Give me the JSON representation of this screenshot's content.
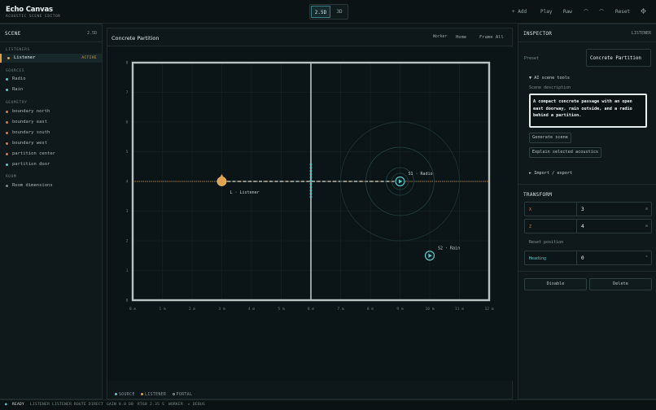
{
  "app": {
    "title": "Echo Canvas",
    "subtitle": "ACOUSTIC SCENE EDITOR"
  },
  "toolbar": {
    "mode_2d": "2.5D",
    "mode_3d": "3D",
    "add": "+ Add",
    "play": "Play",
    "raw": "Raw",
    "undo": "⌒",
    "redo": "⌒",
    "reset": "Reset",
    "settings_icon": "gear-icon"
  },
  "scene": {
    "title": "SCENE",
    "mode": "2.5D",
    "sections": {
      "listeners": "LISTENERS",
      "sources": "SOURCES",
      "geometry": "GEOMETRY",
      "room": "ROOM"
    },
    "listeners": [
      {
        "label": "Listener",
        "badge": "ACTIVE",
        "color": "#d9a14a"
      }
    ],
    "sources": [
      {
        "label": "Radio",
        "color": "#5fc9c9"
      },
      {
        "label": "Rain",
        "color": "#5fc9c9"
      }
    ],
    "geometry": [
      {
        "label": "boundary north",
        "color": "#d97c4a"
      },
      {
        "label": "boundary east",
        "color": "#d97c4a"
      },
      {
        "label": "boundary south",
        "color": "#d97c4a"
      },
      {
        "label": "boundary west",
        "color": "#d97c4a"
      },
      {
        "label": "partition center",
        "color": "#d97c4a"
      },
      {
        "label": "partition door",
        "color": "#5fc9c9"
      }
    ],
    "room": [
      {
        "label": "Room dimensions",
        "color": "#7d8d8f"
      }
    ]
  },
  "viewport": {
    "title": "Concrete Partition",
    "worker": "Worker",
    "home": "Home",
    "frame_all": "Frame All",
    "x_ticks": [
      "0 m",
      "1 m",
      "2 m",
      "3 m",
      "4 m",
      "5 m",
      "6 m",
      "7 m",
      "8 m",
      "9 m",
      "10 m",
      "11 m",
      "12 m"
    ],
    "z_ticks": [
      "8",
      "7",
      "6",
      "5",
      "4",
      "3",
      "2",
      "1",
      "0"
    ],
    "listener_label": "L · Listener",
    "source1_label": "S1 · Radio",
    "source2_label": "S2 · Rain",
    "legend": {
      "source": "SOURCE",
      "listener": "LISTENER",
      "portal": "PORTAL"
    },
    "listener_pos": {
      "x": 3,
      "z": 4
    },
    "source1_pos": {
      "x": 9,
      "z": 4
    },
    "source2_pos": {
      "x": 10,
      "z": 1.5
    },
    "colors": {
      "source": "#5fc9c9",
      "listener": "#e0a24e",
      "wall": "#b8c2c2"
    }
  },
  "inspector": {
    "title": "INSPECTOR",
    "context": "LISTENER",
    "preset_label": "Preset",
    "preset_value": "Concrete Partition",
    "ai_tools": "▼ AI scene tools",
    "scene_desc_label": "Scene description",
    "scene_desc": "A compact concrete passage with an open east doorway, rain outside, and a radio behind a partition.",
    "generate": "Generate scene",
    "explain": "Explain selected acoustics",
    "import_export": "► Import / export",
    "transform_title": "TRANSFORM",
    "x_label": "X",
    "x_value": "3",
    "x_unit": "m",
    "z_label": "Z",
    "z_value": "4",
    "z_unit": "m",
    "reset_position": "Reset position",
    "heading_label": "Heading",
    "heading_value": "0",
    "heading_unit": "°",
    "disable": "Disable",
    "delete": "Delete"
  },
  "status": {
    "ready": "READY",
    "listener": "LISTENER LISTENER",
    "route": "ROUTE DIRECT",
    "gain": "GAIN 0.0 DB",
    "rt60": "RT60 2.35 S",
    "worker": "WORKER",
    "debug": "▸ DEBUG"
  }
}
